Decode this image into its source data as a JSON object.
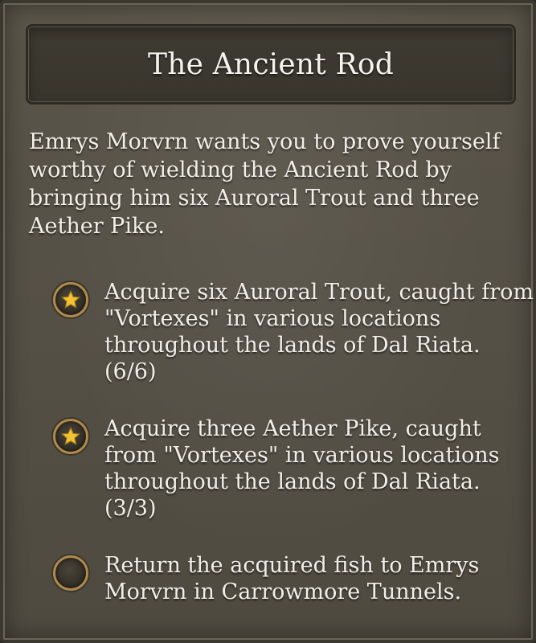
{
  "quest": {
    "title": "The Ancient Rod",
    "description": "Emrys Morvrn wants you to prove yourself worthy of wielding the Ancient Rod by bringing him six Auroral Trout and three Aether Pike."
  },
  "objectives": [
    {
      "text": "Acquire six Auroral Trout, caught from \"Vortexes\" in various locations throughout the lands of Dal Riata. (6/6)",
      "completed": true,
      "icon": "star-icon"
    },
    {
      "text": "Acquire three Aether Pike, caught from \"Vortexes\" in various locations throughout the lands of Dal Riata. (3/3)",
      "completed": true,
      "icon": "star-icon"
    },
    {
      "text": "Return the acquired fish to Emrys Morvrn in Carrowmore Tunnels.",
      "completed": false,
      "icon": "empty-ring-icon"
    }
  ],
  "colors": {
    "panel": "#555046",
    "title_bar": "#3b382f",
    "ring": "#b18a4a",
    "star": "#f2c230",
    "text": "#f2efe8"
  }
}
